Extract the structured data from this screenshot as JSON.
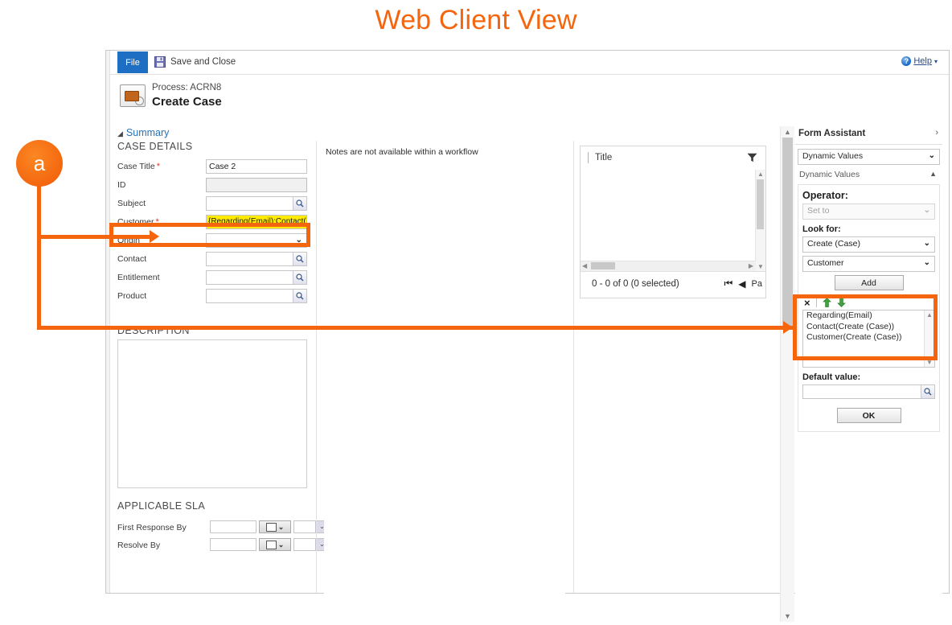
{
  "page": {
    "title": "Web Client View",
    "accent": "#f4650d"
  },
  "annotation": {
    "badge_label": "a"
  },
  "ribbon": {
    "file_tab": "File",
    "save_and_close": "Save and Close",
    "help_label": "Help",
    "help_caret": "▾"
  },
  "process": {
    "subtitle": "Process: ACRN8",
    "title": "Create Case"
  },
  "form": {
    "summary_label": "Summary",
    "summary_caret": "◢",
    "case_details_header": "CASE DETAILS",
    "fields": [
      {
        "label": "Case Title",
        "required": true,
        "type": "text",
        "value": "Case 2"
      },
      {
        "label": "ID",
        "required": false,
        "type": "readonly",
        "value": ""
      },
      {
        "label": "Subject",
        "required": false,
        "type": "lookup",
        "value": ""
      },
      {
        "label": "Customer",
        "required": true,
        "type": "dynamic",
        "value": "{Regarding(Email);Contact(Cr"
      },
      {
        "label": "Origin",
        "required": false,
        "type": "select",
        "value": ""
      },
      {
        "label": "Contact",
        "required": false,
        "type": "lookup",
        "value": ""
      },
      {
        "label": "Entitlement",
        "required": false,
        "type": "lookup",
        "value": ""
      },
      {
        "label": "Product",
        "required": false,
        "type": "lookup",
        "value": ""
      }
    ],
    "description_header": "DESCRIPTION",
    "description_value": "",
    "sla_header": "APPLICABLE SLA",
    "sla_fields": [
      {
        "label": "First Response By",
        "value": ""
      },
      {
        "label": "Resolve By",
        "value": ""
      }
    ]
  },
  "notes": {
    "message": "Notes are not available within a workflow"
  },
  "grid": {
    "column_header": "Title",
    "filter_icon": "funnel-icon",
    "record_count": "0 - 0 of 0 (0 selected)",
    "page_label": "Pa",
    "first_page_icon": "first-page-icon",
    "prev_page_icon": "previous-page-icon"
  },
  "form_assistant": {
    "header": "Form Assistant",
    "collapse_icon": "›",
    "mode_value": "Dynamic Values",
    "section_label": "Dynamic Values",
    "section_caret": "▲",
    "operator_label": "Operator:",
    "operator_value": "Set to",
    "look_for_label": "Look for:",
    "look_for_entity": "Create (Case)",
    "look_for_field": "Customer",
    "add_button": "Add",
    "remove_icon": "×",
    "move_up_icon": "up-arrow-icon",
    "move_down_icon": "down-arrow-icon",
    "values": [
      "Regarding(Email)",
      "Contact(Create (Case))",
      "Customer(Create (Case))"
    ],
    "default_value_label": "Default value:",
    "default_value": "",
    "ok_button": "OK"
  }
}
